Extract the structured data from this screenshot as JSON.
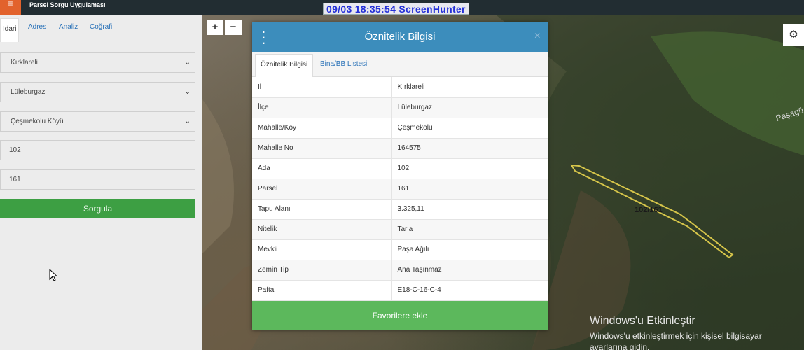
{
  "topbar": {
    "menu_icon": "hamburger-icon",
    "app_title": "Parsel Sorgu Uygulaması",
    "watermark": "09/03  18:35:54  ScreenHunter"
  },
  "left_panel": {
    "tabs": [
      {
        "label": "İdari",
        "active": true
      },
      {
        "label": "Adres",
        "active": false
      },
      {
        "label": "Analiz",
        "active": false
      },
      {
        "label": "Coğrafi",
        "active": false
      }
    ],
    "il_select": "Kırklareli",
    "ilce_select": "Lüleburgaz",
    "mahalle_select": "Çeşmekolu Köyü",
    "ada_input": "102",
    "parsel_input": "161",
    "query_button": "Sorgula"
  },
  "map": {
    "zoom_in": "+",
    "zoom_out": "−",
    "road_label": "Paşagü",
    "parcel_label": "102/161",
    "windows_title": "Windows'u Etkinleştir",
    "windows_text": "Windows'u etkinleştirmek için kişisel bilgisayar ayarlarına gidin."
  },
  "modal": {
    "title": "Öznitelik Bilgisi",
    "close": "×",
    "tabs": [
      {
        "label": "Öznitelik Bilgisi",
        "active": true
      },
      {
        "label": "Bina/BB Listesi",
        "active": false
      }
    ],
    "rows": [
      {
        "key": "İl",
        "value": "Kırklareli"
      },
      {
        "key": "İlçe",
        "value": "Lüleburgaz"
      },
      {
        "key": "Mahalle/Köy",
        "value": "Çeşmekolu"
      },
      {
        "key": "Mahalle No",
        "value": "164575"
      },
      {
        "key": "Ada",
        "value": "102"
      },
      {
        "key": "Parsel",
        "value": "161"
      },
      {
        "key": "Tapu Alanı",
        "value": "3.325,11"
      },
      {
        "key": "Nitelik",
        "value": "Tarla"
      },
      {
        "key": "Mevkii",
        "value": "Paşa Ağılı"
      },
      {
        "key": "Zemin Tip",
        "value": "Ana Taşınmaz"
      },
      {
        "key": "Pafta",
        "value": "E18-C-16-C-4"
      }
    ],
    "favorite_button": "Favorilere ekle"
  }
}
